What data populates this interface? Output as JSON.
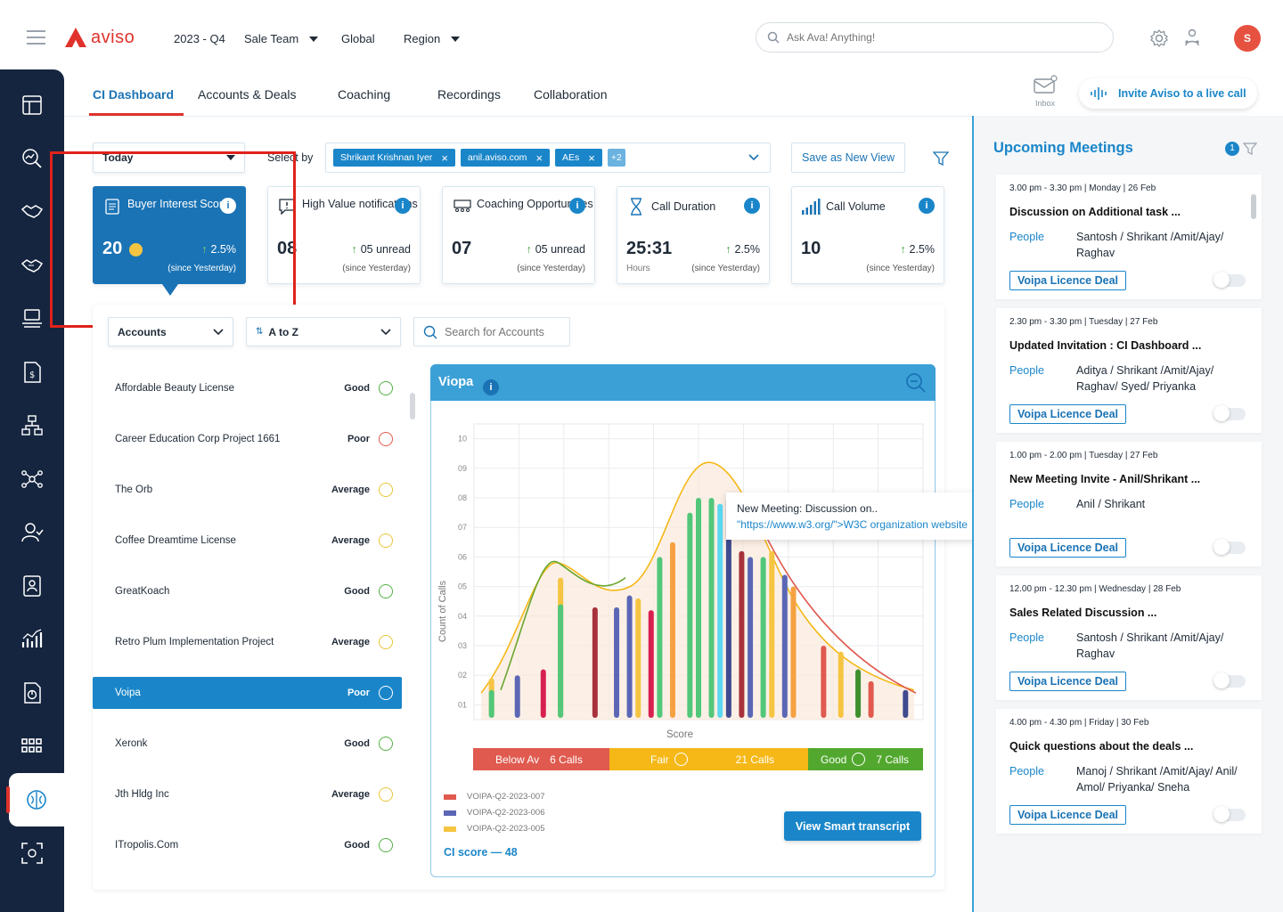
{
  "header": {
    "logo_text": "aviso",
    "period": "2023 - Q4",
    "team": "Sale Team",
    "scope": "Global",
    "region": "Region",
    "search_placeholder": "Ask Ava! Anything!",
    "avatar_initial": "S"
  },
  "tabs": [
    "CI Dashboard",
    "Accounts & Deals",
    "Coaching",
    "Recordings",
    "Collaboration"
  ],
  "inbox_label": "Inbox",
  "invite_label": "Invite Aviso to a live call",
  "filters": {
    "date": "Today",
    "select_by": "Select by",
    "chips": [
      "Shrikant Krishnan Iyer",
      "anil.aviso.com",
      "AEs"
    ],
    "more": "+2",
    "save_view": "Save as New View"
  },
  "cards": [
    {
      "title": "Buyer Interest Score",
      "value": "20",
      "delta": "2.5%",
      "since": "(since Yesterday)"
    },
    {
      "title": "High Value notifications",
      "value": "08",
      "delta": "05 unread",
      "since": "(since Yesterday)"
    },
    {
      "title": "Coaching Opportunities",
      "value": "07",
      "delta": "05 unread",
      "since": "(since Yesterday)"
    },
    {
      "title": "Call Duration",
      "value": "25:31",
      "sub": "Hours",
      "delta": "2.5%",
      "since": "(since Yesterday)"
    },
    {
      "title": "Call Volume",
      "value": "10",
      "delta": "2.5%",
      "since": "(since Yesterday)"
    }
  ],
  "accounts_panel": {
    "type_select": "Accounts",
    "sort_select": "A to Z",
    "search_placeholder": "Search for Accounts",
    "items": [
      {
        "name": "Affordable Beauty License",
        "status": "Good"
      },
      {
        "name": "Career Education Corp Project 1661",
        "status": "Poor"
      },
      {
        "name": "The Orb",
        "status": "Average"
      },
      {
        "name": "Coffee Dreamtime License",
        "status": "Average"
      },
      {
        "name": "GreatKoach",
        "status": "Good"
      },
      {
        "name": "Retro Plum Implementation Project",
        "status": "Average"
      },
      {
        "name": "Voipa",
        "status": "Poor"
      },
      {
        "name": "Xeronk",
        "status": "Good"
      },
      {
        "name": "Jth Hldg Inc",
        "status": "Average"
      },
      {
        "name": "ITropolis.Com",
        "status": "Good"
      }
    ],
    "status_colors": {
      "Good": "#52b043",
      "Poor": "#e05a4f",
      "Average": "#e8c53a"
    }
  },
  "chart_panel": {
    "title": "Viopa",
    "tooltip_line1": "New Meeting: Discussion on..",
    "tooltip_line2": "\"https://www.w3.org/\">W3C organization website",
    "bands": [
      {
        "label": "Below Av",
        "count": "6 Calls",
        "color": "#e05a4f"
      },
      {
        "label": "Fair",
        "count": "21 Calls",
        "color": "#f5b817"
      },
      {
        "label": "Good",
        "count": "7 Calls",
        "color": "#52a82e"
      }
    ],
    "legend": [
      {
        "name": "VOIPA-Q2-2023-007",
        "color": "#e05a4f"
      },
      {
        "name": "VOIPA-Q2-2023-006",
        "color": "#5b67b5"
      },
      {
        "name": "VOIPA-Q2-2023-005",
        "color": "#f5c542"
      }
    ],
    "ci_score": "CI score — 48",
    "transcript_button": "View Smart transcript"
  },
  "chart_data": {
    "type": "bar",
    "ylabel": "Count of Calls",
    "xlabel": "Score",
    "yticks": [
      "01",
      "02",
      "03",
      "04",
      "05",
      "06",
      "07",
      "08",
      "09",
      "10"
    ],
    "ylim": [
      0.5,
      10.5
    ],
    "bars": [
      {
        "pos": 0.02,
        "value": 1.9,
        "color": "#f5c542"
      },
      {
        "pos": 0.02,
        "value": 1.5,
        "color": "#52c77a"
      },
      {
        "pos": 0.08,
        "value": 2.0,
        "color": "#5b67b5"
      },
      {
        "pos": 0.14,
        "value": 2.2,
        "color": "#d8204f"
      },
      {
        "pos": 0.18,
        "value": 5.3,
        "color": "#f5c542"
      },
      {
        "pos": 0.18,
        "value": 4.4,
        "color": "#52c77a"
      },
      {
        "pos": 0.26,
        "value": 4.3,
        "color": "#a8323c"
      },
      {
        "pos": 0.31,
        "value": 4.3,
        "color": "#5b67b5"
      },
      {
        "pos": 0.34,
        "value": 4.7,
        "color": "#5b67b5"
      },
      {
        "pos": 0.36,
        "value": 4.6,
        "color": "#f5c542"
      },
      {
        "pos": 0.39,
        "value": 4.2,
        "color": "#d8204f"
      },
      {
        "pos": 0.41,
        "value": 6.0,
        "color": "#52c77a"
      },
      {
        "pos": 0.44,
        "value": 6.5,
        "color": "#f5a142"
      },
      {
        "pos": 0.48,
        "value": 7.5,
        "color": "#52c77a"
      },
      {
        "pos": 0.5,
        "value": 8.0,
        "color": "#52c77a"
      },
      {
        "pos": 0.53,
        "value": 8.0,
        "color": "#52c77a"
      },
      {
        "pos": 0.55,
        "value": 7.8,
        "color": "#5bd8f2"
      },
      {
        "pos": 0.57,
        "value": 8.0,
        "color": "#3f4a8f"
      },
      {
        "pos": 0.6,
        "value": 6.2,
        "color": "#a8323c"
      },
      {
        "pos": 0.62,
        "value": 6.0,
        "color": "#5b67b5"
      },
      {
        "pos": 0.65,
        "value": 6.0,
        "color": "#52c77a"
      },
      {
        "pos": 0.67,
        "value": 6.2,
        "color": "#f5c542"
      },
      {
        "pos": 0.7,
        "value": 5.4,
        "color": "#5b67b5"
      },
      {
        "pos": 0.72,
        "value": 5.0,
        "color": "#f5a142"
      },
      {
        "pos": 0.79,
        "value": 3.0,
        "color": "#e05a4f"
      },
      {
        "pos": 0.83,
        "value": 2.8,
        "color": "#f5c542"
      },
      {
        "pos": 0.87,
        "value": 2.2,
        "color": "#3f8f2e"
      },
      {
        "pos": 0.9,
        "value": 1.8,
        "color": "#e05a4f"
      },
      {
        "pos": 0.98,
        "value": 1.5,
        "color": "#3f4a8f"
      }
    ]
  },
  "meetings": {
    "title": "Upcoming Meetings",
    "count": "1",
    "people_label": "People",
    "items": [
      {
        "time": "3.00 pm - 3.30 pm | Monday | 26 Feb",
        "title": "Discussion on Additional task ...",
        "people": "Santosh / Shrikant /Amit/Ajay/ Raghav",
        "deal": "Voipa Licence Deal"
      },
      {
        "time": "2.30 pm - 3.30 pm | Tuesday | 27 Feb",
        "title": "Updated Invitation : CI Dashboard ...",
        "people": "Aditya / Shrikant /Amit/Ajay/ Raghav/ Syed/ Priyanka",
        "deal": "Voipa Licence Deal"
      },
      {
        "time": "1.00 pm - 2.00 pm | Tuesday | 27 Feb",
        "title": "New Meeting Invite - Anil/Shrikant ...",
        "people": "Anil / Shrikant",
        "deal": "Voipa Licence Deal"
      },
      {
        "time": "12.00 pm - 12.30 pm | Wednesday | 28 Feb",
        "title": "Sales Related Discussion ...",
        "people": "Santosh / Shrikant /Amit/Ajay/ Raghav",
        "deal": "Voipa Licence Deal"
      },
      {
        "time": "4.00 pm - 4.30 pm | Friday | 30 Feb",
        "title": "Quick questions about the deals ...",
        "people": "Manoj / Shrikant /Amit/Ajay/ Anil/ Amol/ Priyanka/ Sneha",
        "deal": "Voipa Licence Deal"
      }
    ]
  },
  "colors": {
    "primary": "#1a73b5",
    "sidebar": "#15253f",
    "accent_red": "#e0322b"
  }
}
